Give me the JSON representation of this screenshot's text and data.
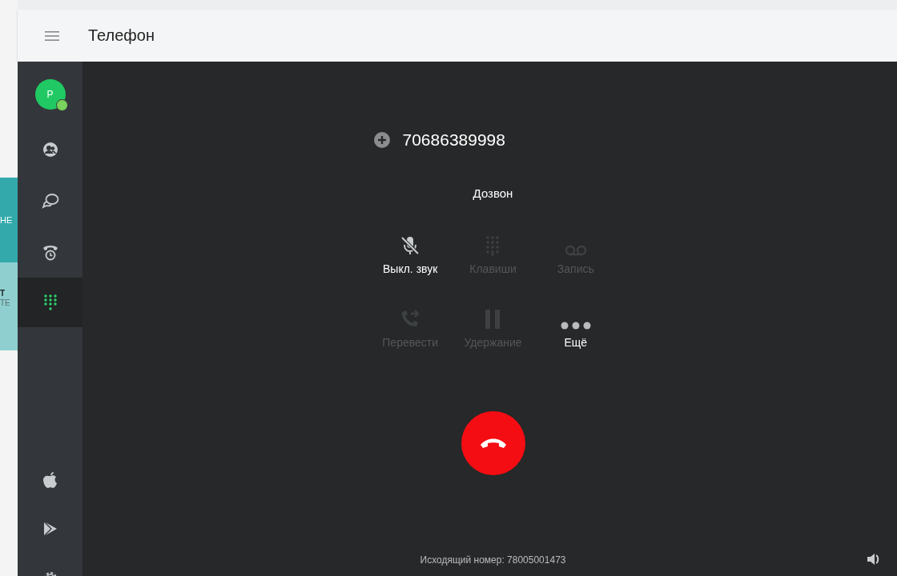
{
  "background_page": {
    "texts": [
      "НЕ",
      "Т",
      "ТЕ"
    ]
  },
  "header": {
    "title": "Телефон"
  },
  "sidebar": {
    "avatar": {
      "initial": "P",
      "online": true
    },
    "items": [
      {
        "kind": "contacts",
        "selected": false
      },
      {
        "kind": "chats",
        "selected": false
      },
      {
        "kind": "history",
        "selected": false
      },
      {
        "kind": "dialpad",
        "selected": true
      }
    ],
    "bottom_items": [
      {
        "kind": "apple"
      },
      {
        "kind": "play"
      },
      {
        "kind": "settings"
      }
    ]
  },
  "call": {
    "number": "70686389998",
    "status": "Дозвон",
    "controls": [
      {
        "kind": "mute",
        "label": "Выкл. звук",
        "disabled": false
      },
      {
        "kind": "keypad",
        "label": "Клавиши",
        "disabled": true
      },
      {
        "kind": "record",
        "label": "Запись",
        "disabled": true
      },
      {
        "kind": "transfer",
        "label": "Перевести",
        "disabled": true
      },
      {
        "kind": "hold",
        "label": "Удержание",
        "disabled": true
      },
      {
        "kind": "more",
        "label": "Ещё",
        "disabled": false
      }
    ],
    "outgoing": "Исходящий номер: 78005001473"
  }
}
